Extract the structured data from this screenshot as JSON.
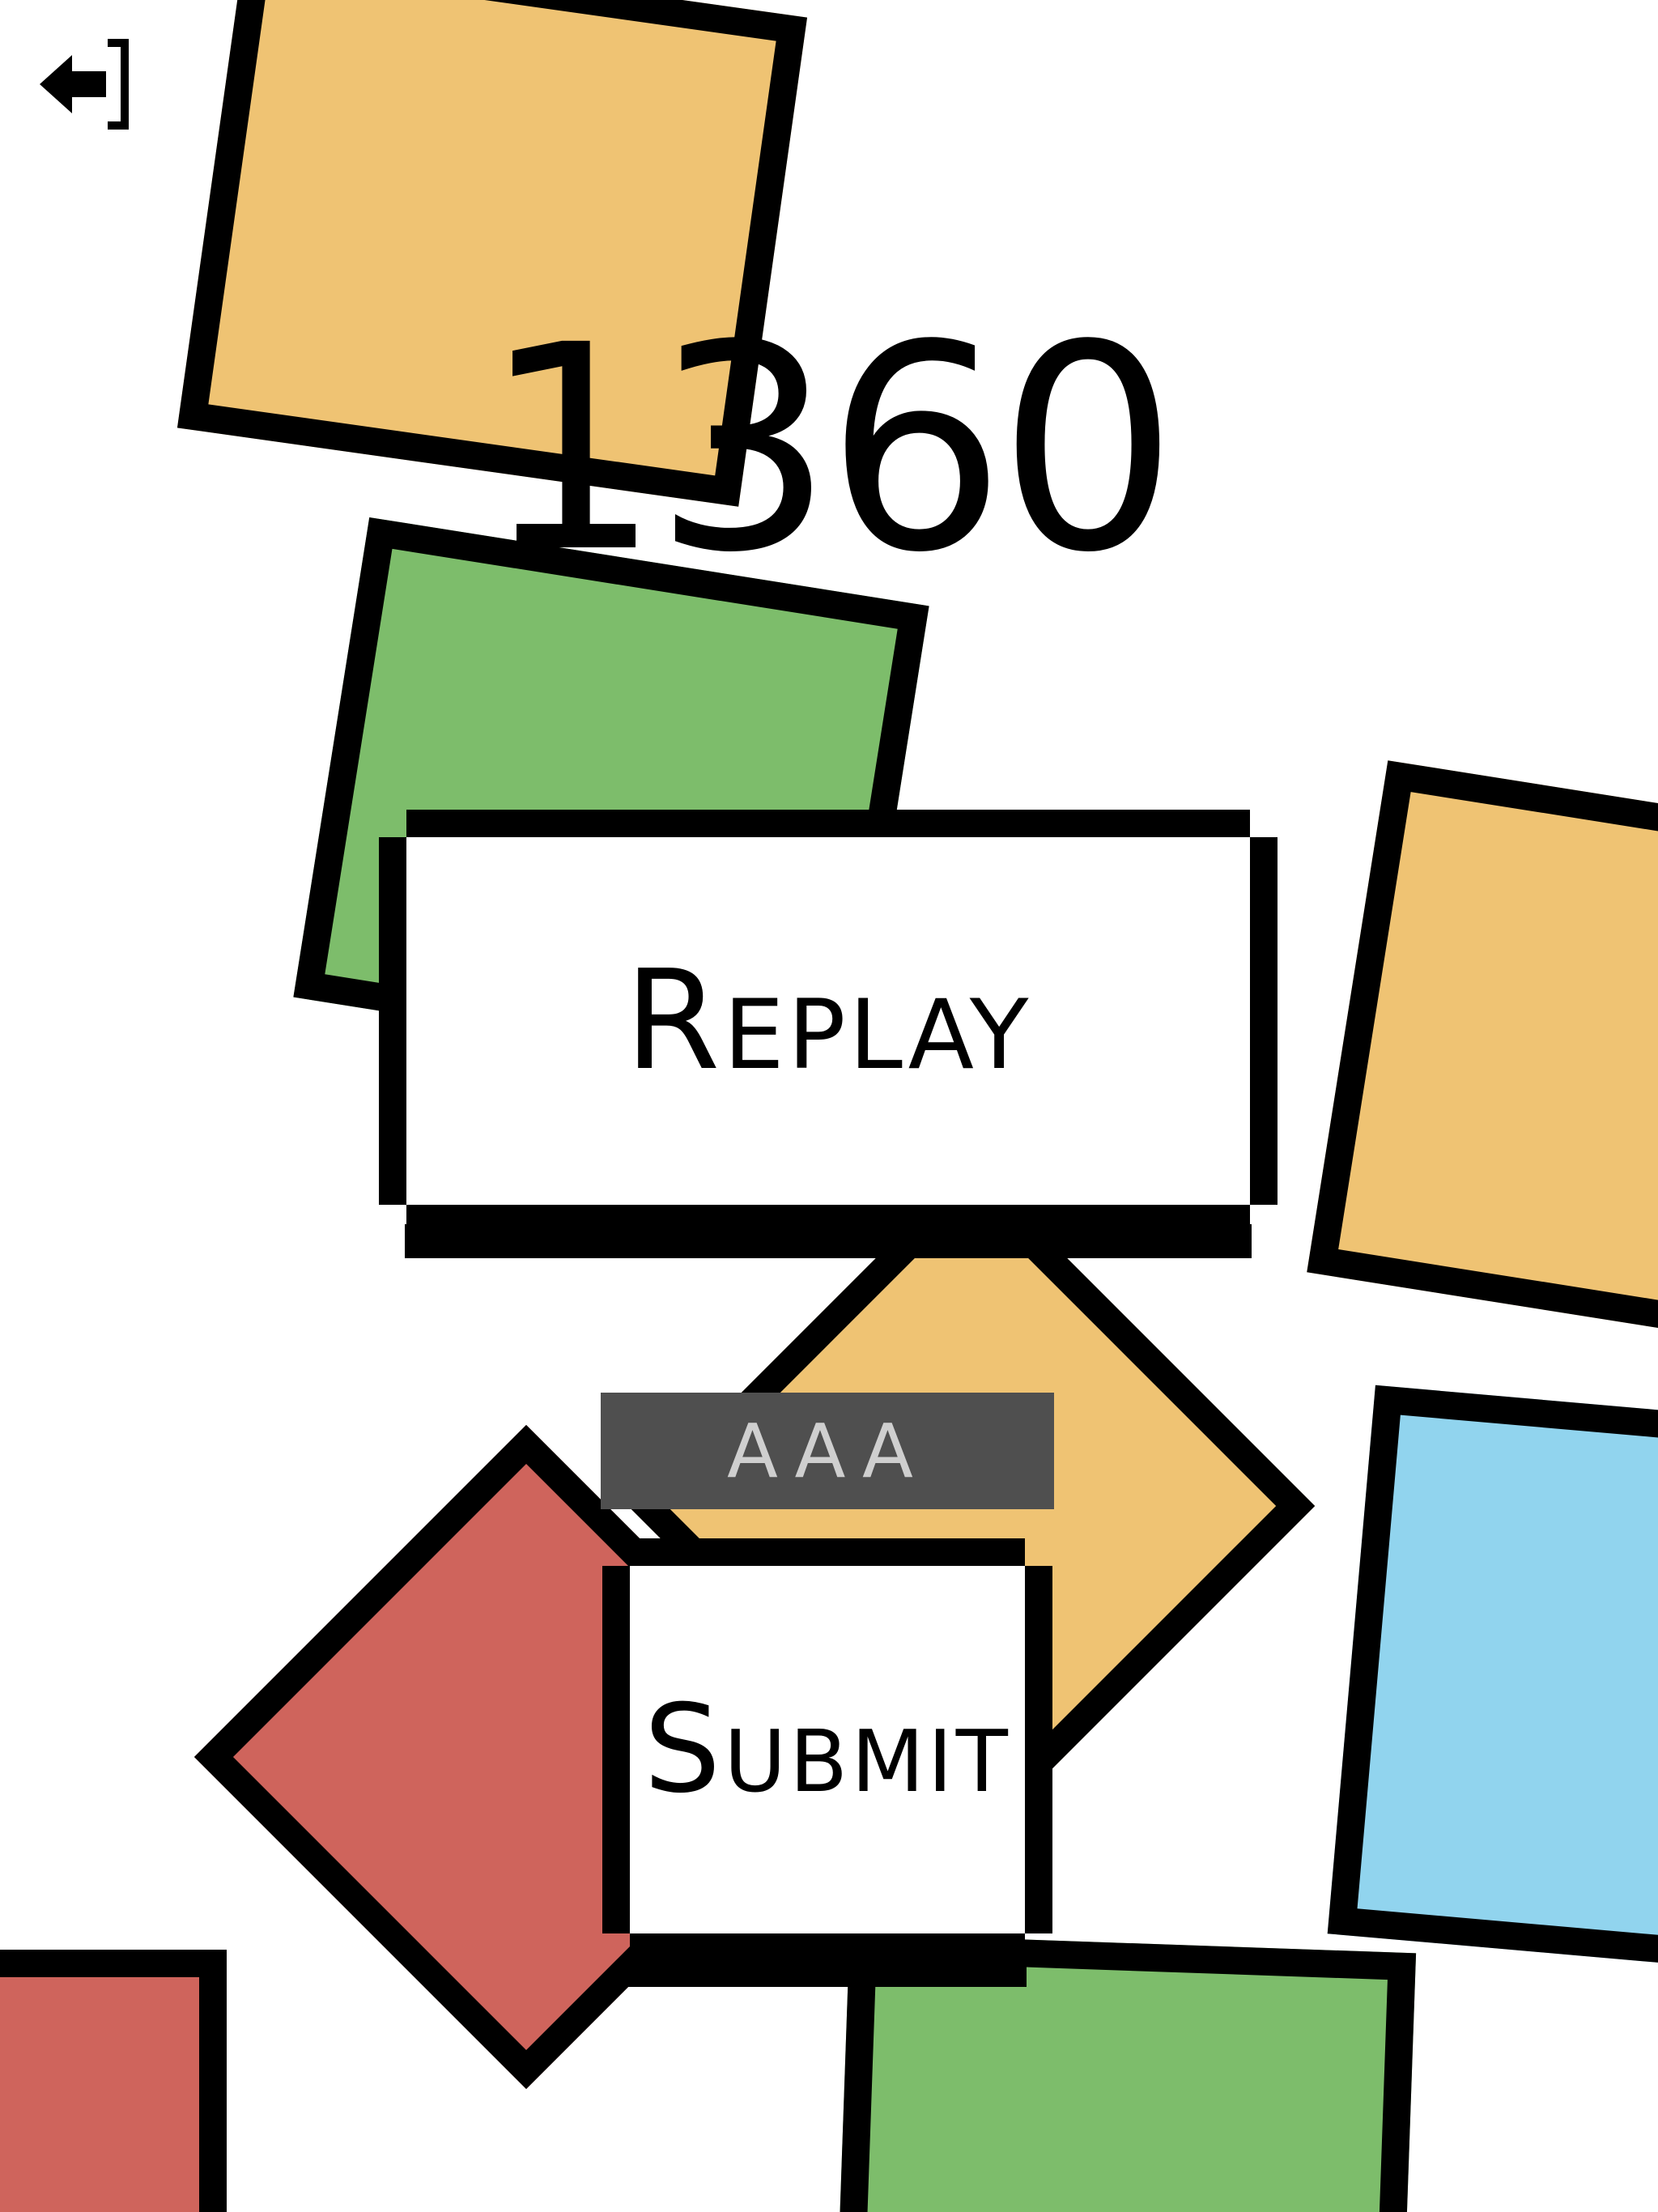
{
  "game": {
    "score": "1360",
    "replay_label": "Replay",
    "submit_label": "Submit",
    "name_value": "AAA"
  },
  "icons": {
    "exit": "exit-door-arrow-icon"
  },
  "palette": {
    "background": "#ffffff",
    "outline": "#000000",
    "orange": "#efc373",
    "green": "#7dbd6b",
    "red": "#cf645c",
    "blue": "#91d4ee",
    "field": "#4f4f4f",
    "field_text": "#cfcfcf"
  }
}
